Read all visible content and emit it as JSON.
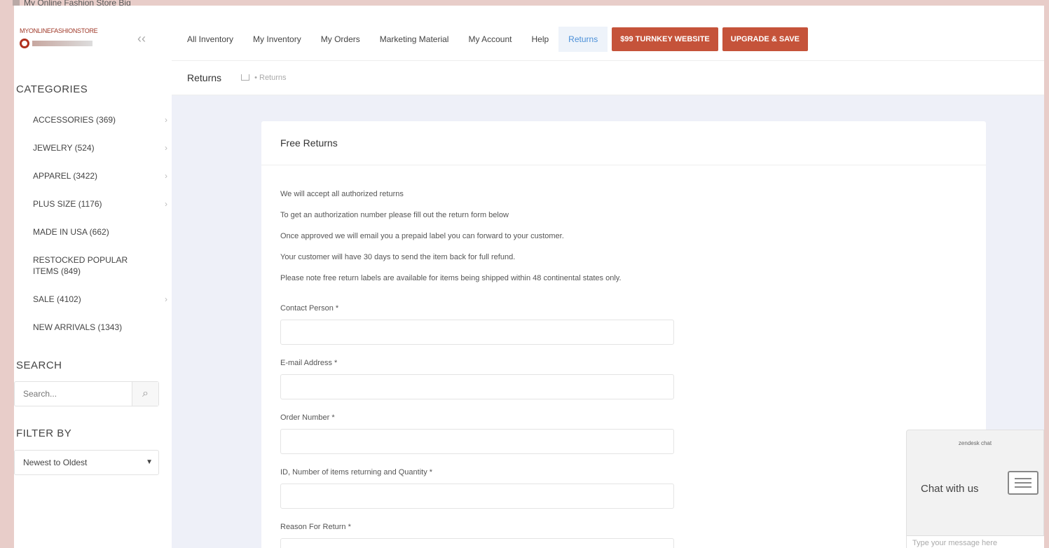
{
  "window": {
    "title": "My Online Fashion Store Big"
  },
  "sidebar": {
    "logo_text": "MYONLINEFASHIONSTORE",
    "categories_title": "CATEGORIES",
    "categories": [
      {
        "label": "ACCESSORIES (369)",
        "chevron": true
      },
      {
        "label": "JEWELRY (524)",
        "chevron": true
      },
      {
        "label": "APPAREL (3422)",
        "chevron": true
      },
      {
        "label": "PLUS SIZE (1176)",
        "chevron": true
      },
      {
        "label": "MADE IN USA (662)",
        "chevron": false
      },
      {
        "label": "RESTOCKED POPULAR ITEMS (849)",
        "chevron": false
      },
      {
        "label": "SALE (4102)",
        "chevron": true
      },
      {
        "label": "NEW ARRIVALS (1343)",
        "chevron": false
      }
    ],
    "search_title": "SEARCH",
    "search_placeholder": "Search...",
    "filter_title": "FILTER BY",
    "filter_value": "Newest to Oldest"
  },
  "nav": {
    "items": [
      "All Inventory",
      "My Inventory",
      "My Orders",
      "Marketing Material",
      "My Account",
      "Help",
      "Returns"
    ],
    "active": "Returns",
    "buttons": [
      "$99 TURNKEY WEBSITE",
      "UPGRADE & SAVE"
    ],
    "accent": "#c5533a"
  },
  "subheader": {
    "title": "Returns",
    "crumb": "Returns"
  },
  "card": {
    "title": "Free Returns",
    "paragraphs": [
      "We will accept all authorized returns",
      "To get an authorization number please fill out the return form below",
      "Once approved we will email you a prepaid label you can forward to your customer.",
      "Your customer will have 30 days to send the item back for full refund.",
      "Please note free return labels are available for items being shipped within 48 continental states only."
    ],
    "fields": [
      "Contact Person *",
      "E-mail Address *",
      "Order Number *",
      "ID, Number of items returning and Quantity *",
      "Reason For Return *"
    ]
  },
  "chat": {
    "brand": "zendesk chat",
    "label": "Chat with us",
    "input_placeholder": "Type your message here"
  }
}
